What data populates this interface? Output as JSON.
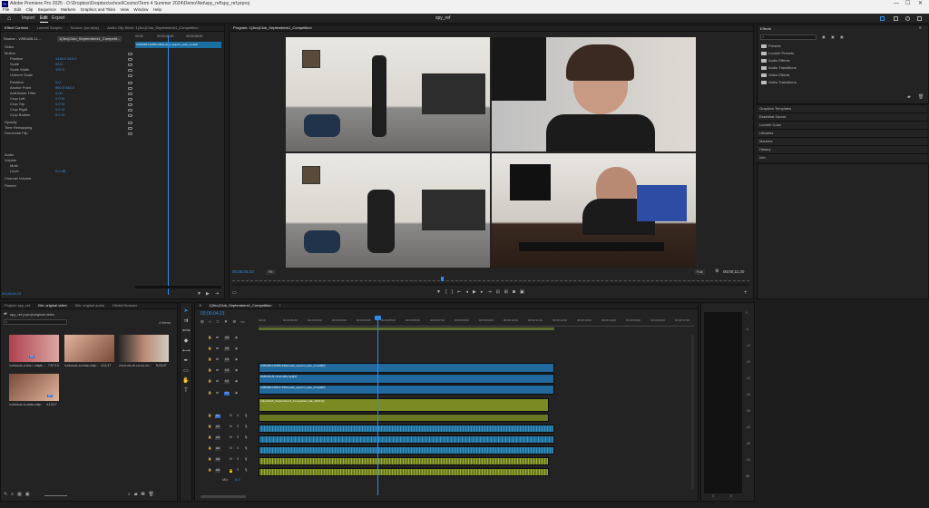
{
  "titlebar": {
    "title": "Adobe Premiere Pro 2025 - D:\\Dropbox\\Dropbox\\school\\Cosmo\\Term 4 Summer 2024\\Demo\\Net\\spy_ref\\spy_ref.prproj",
    "logo": "Pr"
  },
  "menu": [
    "File",
    "Edit",
    "Clip",
    "Sequence",
    "Markers",
    "Graphics and Titles",
    "View",
    "Window",
    "Help"
  ],
  "appbar": {
    "home": "Home",
    "import": "Import",
    "edit": "Edit",
    "export": "Export",
    "project_name": "spy_ref"
  },
  "effect_controls": {
    "tabs": [
      "Effect Controls",
      "Lumetri Scopes",
      "Source: (no clips)",
      "Audio Clip Mixer: 1(3ec)Club_Septembers1_Competition"
    ],
    "source": "Source - V250428-11...",
    "clip_label": "1(3ec)Club_Septembers1_Competit...",
    "ruler": [
      "00:00",
      "00:00;04;00",
      "00;00;08;00"
    ],
    "clip_bar": "V250428-112956-34fps-auto_sep-tim_auto_comp#",
    "section_video": "Video",
    "props": [
      {
        "name": "Motion",
        "value": ""
      },
      {
        "name": "Position",
        "value": "1440.0    810.0"
      },
      {
        "name": "Scale",
        "value": "50.0"
      },
      {
        "name": "Scale Width",
        "value": "100.0"
      },
      {
        "name": "Uniform Scale",
        "value": ""
      },
      {
        "name": "Rotation",
        "value": "0.0"
      },
      {
        "name": "Anchor Point",
        "value": "960.0    540.0"
      },
      {
        "name": "Anti-flicker Filter",
        "value": "0.00"
      },
      {
        "name": "Crop Left",
        "value": "0.0 %"
      },
      {
        "name": "Crop Top",
        "value": "0.0 %"
      },
      {
        "name": "Crop Right",
        "value": "0.0 %"
      },
      {
        "name": "Crop Bottom",
        "value": "0.0 %"
      },
      {
        "name": "Opacity",
        "value": ""
      },
      {
        "name": "Time Remapping",
        "value": ""
      },
      {
        "name": "Horizontal Flip",
        "value": ""
      }
    ],
    "section_audio": "Audio",
    "audio_props": [
      {
        "name": "Volume",
        "value": ""
      },
      {
        "name": "Mute",
        "value": ""
      },
      {
        "name": "Level",
        "value": "0.0 dB"
      },
      {
        "name": "Channel Volume",
        "value": ""
      },
      {
        "name": "Panner",
        "value": ""
      }
    ],
    "timecode": "00;00;04;23"
  },
  "program": {
    "title": "Program: 1(3ec)Club_Septembers1_Competition",
    "timecode": "00;00;04;23",
    "fit": "Fit",
    "quality": "Full",
    "duration": "00;00;11;20"
  },
  "effects": {
    "title": "Effects",
    "folders": [
      "Presets",
      "Lumetri Presets",
      "Audio Effects",
      "Audio Transitions",
      "Video Effects",
      "Video Transitions"
    ],
    "panels": [
      "Graphics Templates",
      "Essential Sound",
      "Lumetri Color",
      "Libraries",
      "Markers",
      "History",
      "Info"
    ]
  },
  "project": {
    "tabs": [
      "Project: spy_ref",
      "Bin: original video",
      "Bin: original audio",
      "Media Browser"
    ],
    "path": "spy_ref.prproj\\original video",
    "count": "4 items",
    "items": [
      {
        "name": "V250428-115417-34fps-...",
        "dur": "7;07;13"
      },
      {
        "name": "V250428-112956-34fp...",
        "dur": "4;11;17"
      },
      {
        "name": "2025-06-26 15-43-30...",
        "dur": "5;16;47"
      },
      {
        "name": "V250428-112856-34fp...",
        "dur": "4;13;17"
      }
    ]
  },
  "timeline": {
    "tab": "1(3ec)Club_Septembers1_Competition",
    "timecode": "00;00;04;23",
    "ruler": [
      "00;00",
      "00;00;01;00",
      "00;00;02;00",
      "00;00;03;00",
      "00;00;04;00",
      "00;00;05;00",
      "00;00;06;00",
      "00;00;07;00",
      "00;00;08;00",
      "00;00;09;00",
      "00;00;10;00",
      "00;00;11;00",
      "00;00;12;00",
      "00;00;13;00",
      "00;00;14;00",
      "00;00;15;00",
      "00;00;16;00",
      "00;00;17;00"
    ],
    "video_tracks": [
      "V6",
      "V5",
      "V4",
      "V3",
      "V2",
      "V1"
    ],
    "audio_tracks": [
      "A1",
      "A2",
      "A3",
      "A4",
      "A5",
      "A6"
    ],
    "mix": "Mix",
    "mix_value": "0.0",
    "clips": [
      "V250428-112956-34fps-auto_sep-tim_auto_comp#[V]",
      "2025-06-26 15-43-30a.mp4[V]",
      "V250428-115417-34fps-auto_sep-tim_auto_comp#[V]",
      "1(3ec)Club_Septembers1_Competition_tak_2019.[V]"
    ]
  },
  "meter": {
    "labels": [
      "0",
      "-6",
      "-12",
      "-18",
      "-24",
      "-30",
      "-36",
      "-42",
      "-48",
      "-54",
      "dB"
    ],
    "bottom": [
      "S",
      "S"
    ]
  },
  "colors": {
    "accent": "#2d8ceb",
    "video_clip": "#226a9d",
    "audio_clip": "#1f6f98",
    "green_clip": "#7c8a24",
    "playhead": "#2d8ceb"
  }
}
